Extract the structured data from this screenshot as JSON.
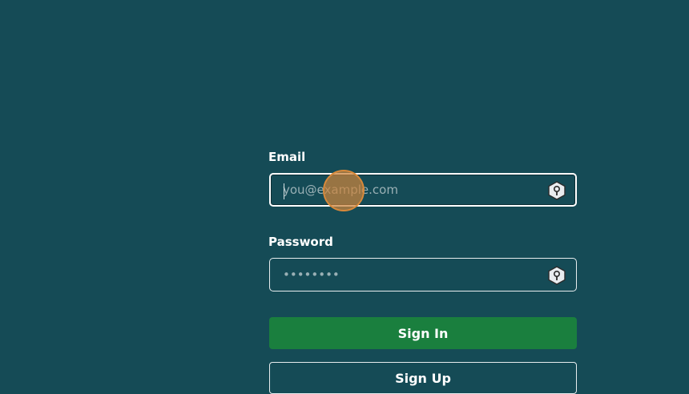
{
  "form": {
    "email": {
      "label": "Email",
      "placeholder": "you@example.com",
      "value": "",
      "icon": "key-icon"
    },
    "password": {
      "label": "Password",
      "placeholder": "••••••••",
      "value": "",
      "icon": "key-icon"
    },
    "sign_in_label": "Sign In",
    "sign_up_label": "Sign Up"
  },
  "colors": {
    "background": "#154b56",
    "primary_button": "#1a7f3e",
    "click_marker": "#cc843c"
  }
}
